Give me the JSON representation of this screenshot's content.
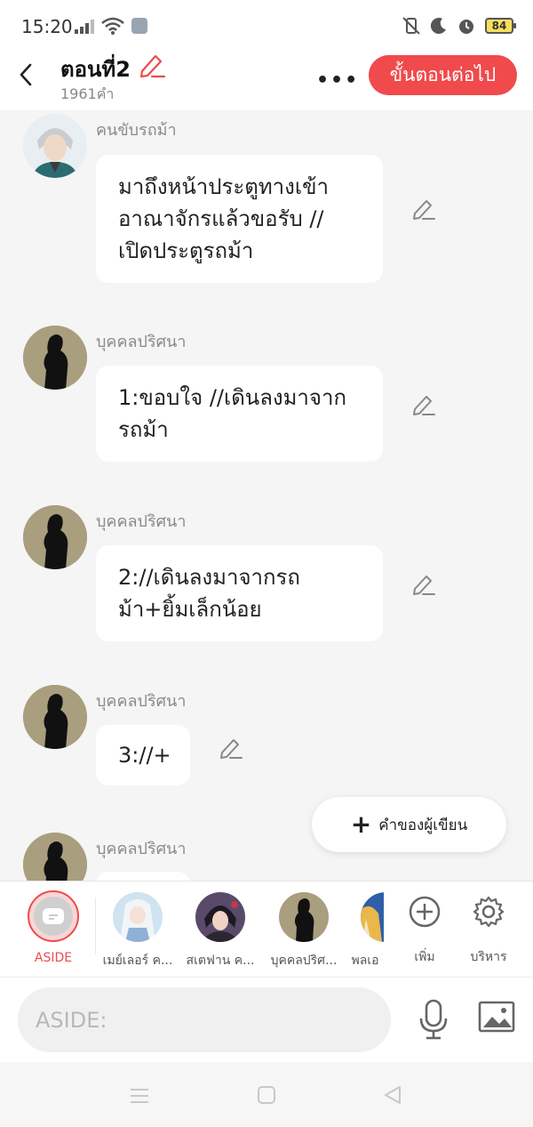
{
  "status_bar": {
    "time": "15:20",
    "battery": "84"
  },
  "header": {
    "title": "ตอนที่2",
    "word_count": "1961คำ",
    "more": "•••",
    "next_button": "ขั้นตอนต่อไป"
  },
  "messages": [
    {
      "speaker": "คนขับรถม้า",
      "lines": [
        "มาถึงหน้าประตูทางเข้า",
        "อาณาจักรแล้วขอรับ //",
        "เปิดประตูรถม้า"
      ]
    },
    {
      "speaker": "บุคคลปริศนา",
      "lines": [
        "1:ขอบใจ //เดินลงมาจาก",
        "รถม้า"
      ]
    },
    {
      "speaker": "บุคคลปริศนา",
      "lines": [
        "2://เดินลงมาจากรถ",
        "ม้า+ยิ้มเล็กน้อย"
      ]
    },
    {
      "speaker": "บุคคลปริศนา",
      "lines": [
        "3://+"
      ]
    },
    {
      "speaker": "บุคคลปริศนา",
      "lines": [
        ""
      ]
    }
  ],
  "author_note_button": "คำของผู้เขียน",
  "characters": [
    {
      "label": "ASIDE",
      "icon": "aside-icon"
    },
    {
      "label": "เมย์เลอร์ ค...",
      "icon": "avatar-white-hair"
    },
    {
      "label": "สเตฟาน ค...",
      "icon": "avatar-dark-hair"
    },
    {
      "label": "บุคคลปริศ...",
      "icon": "avatar-silhouette"
    },
    {
      "label": "พลเอ",
      "icon": "avatar-partial"
    },
    {
      "label": "เพิ่ม",
      "icon": "add-circle-icon"
    },
    {
      "label": "บริหาร",
      "icon": "gear-icon"
    }
  ],
  "input": {
    "placeholder": "ASIDE:"
  },
  "colors": {
    "accent": "#f04a4c",
    "background": "#f5f5f5"
  }
}
